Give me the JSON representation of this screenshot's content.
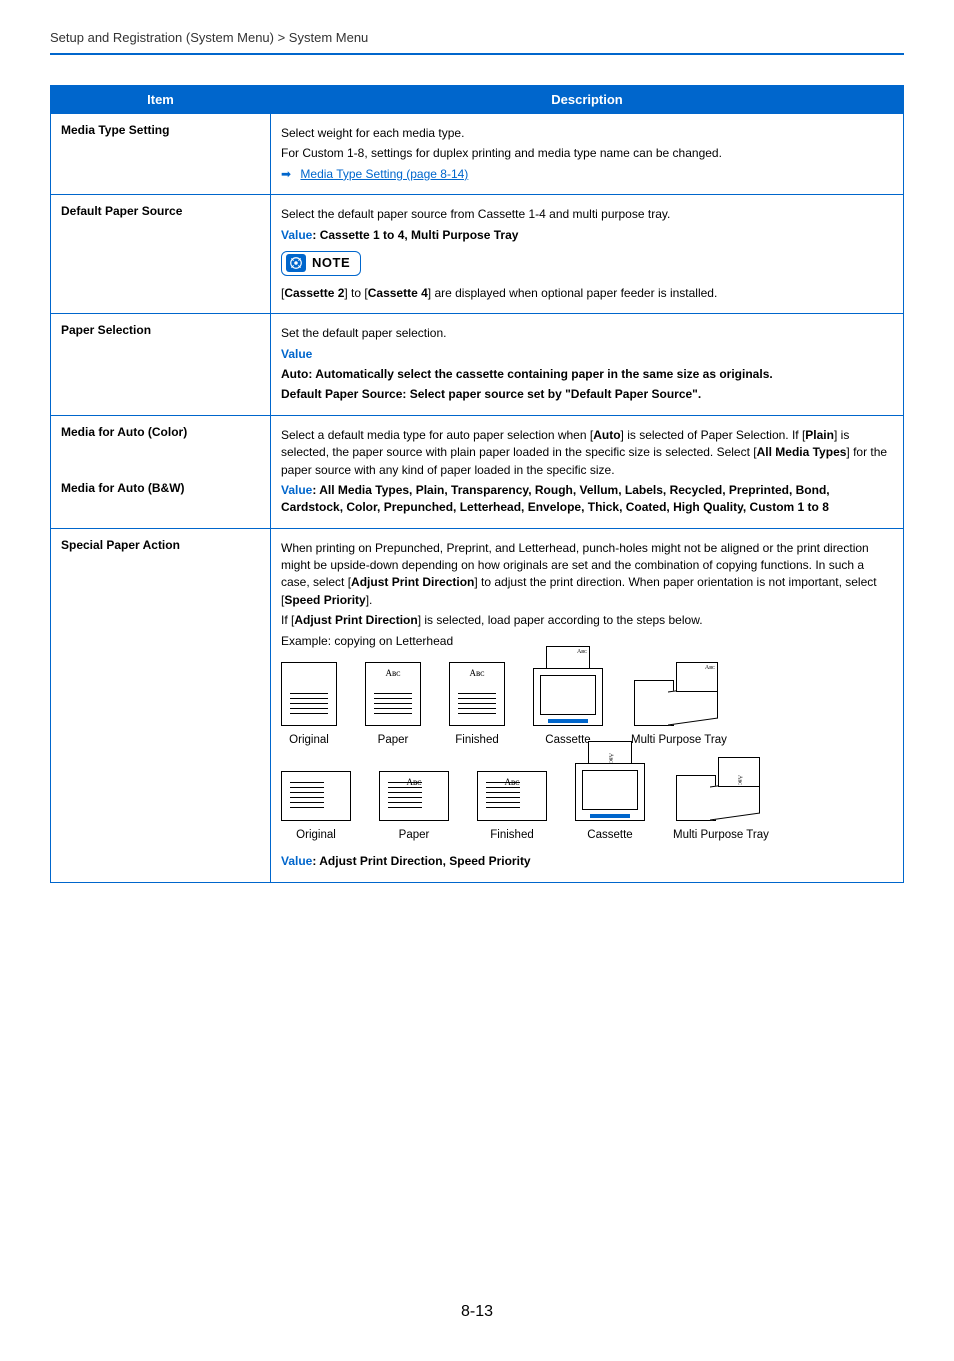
{
  "breadcrumb": "Setup and Registration (System Menu) > System Menu",
  "headers": {
    "item": "Item",
    "description": "Description"
  },
  "rows": {
    "media_type_setting": {
      "item": "Media Type Setting",
      "line1": "Select weight for each media type.",
      "line2": "For Custom 1-8, settings for duplex printing and media type name can be changed.",
      "link": "Media Type Setting (page 8-14)"
    },
    "default_paper_source": {
      "item": "Default Paper Source",
      "line1": "Select the default paper source from Cassette 1-4 and multi purpose tray.",
      "value_label": "Value",
      "value_text": ": Cassette 1 to 4, Multi Purpose Tray",
      "note_label": "NOTE",
      "note_text_pre": "[",
      "note_bold1": "Cassette 2",
      "note_mid": "] to [",
      "note_bold2": "Cassette 4",
      "note_text_post": "] are displayed when optional paper feeder is installed."
    },
    "paper_selection": {
      "item": "Paper Selection",
      "line1": "Set the default paper selection.",
      "value_label": "Value",
      "line2": "Auto: Automatically select the cassette containing paper in the same size as originals.",
      "line3": "Default Paper Source: Select paper source set by \"Default Paper Source\"."
    },
    "media_auto": {
      "item1": "Media for Auto (Color)",
      "item2": "Media for Auto (B&W)",
      "desc_pre": "Select a default media type for auto paper selection when [",
      "desc_b1": "Auto",
      "desc_mid1": "] is selected of Paper Selection. If [",
      "desc_b2": "Plain",
      "desc_mid2": "] is selected, the paper source with plain paper loaded in the specific size is selected. Select [",
      "desc_b3": "All Media Types",
      "desc_post": "] for the paper source with any kind of paper loaded in the specific size.",
      "value_label": "Value",
      "value_text": ": All Media Types, Plain, Transparency, Rough, Vellum, Labels, Recycled, Preprinted, Bond, Cardstock, Color, Prepunched, Letterhead, Envelope, Thick, Coated, High Quality, Custom 1 to 8"
    },
    "special_paper": {
      "item": "Special Paper Action",
      "p1_pre": "When printing on Prepunched, Preprint, and Letterhead, punch-holes might not be aligned or the print direction might be upside-down depending on how originals are set and the combination of copying functions. In such a case, select [",
      "p1_b1": "Adjust Print Direction",
      "p1_mid": "] to adjust the print direction. When paper orientation is not important, select [",
      "p1_b2": "Speed Priority",
      "p1_post": "].",
      "p2_pre": "If [",
      "p2_b1": "Adjust Print Direction",
      "p2_post": "] is selected, load paper according to the steps below.",
      "p3": "Example: copying on Letterhead",
      "labels": {
        "original": "Original",
        "paper": "Paper",
        "finished": "Finished",
        "cassette": "Cassette",
        "mptray": "Multi Purpose Tray"
      },
      "value_label": "Value",
      "value_text": ": Adjust Print Direction, Speed Priority"
    }
  },
  "page_number": "8-13"
}
